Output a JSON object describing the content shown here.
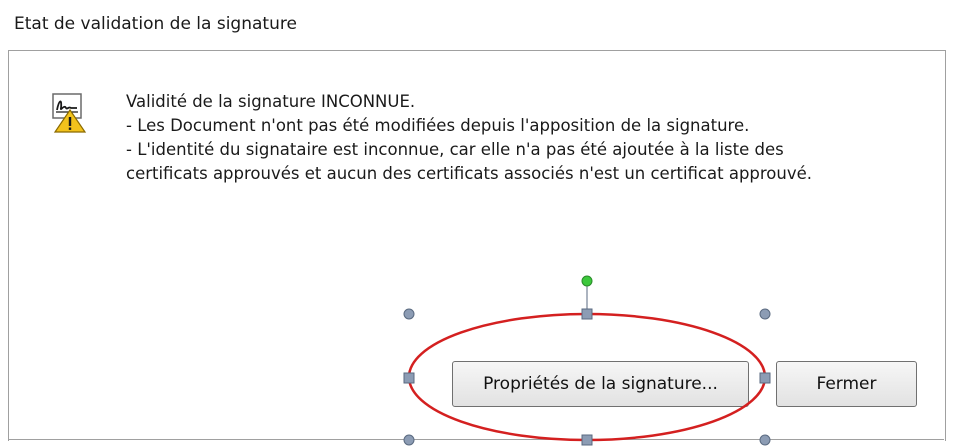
{
  "window": {
    "title": "Etat de validation de la signature"
  },
  "message": {
    "lines": [
      "Validité de la signature INCONNUE.",
      "- Les Document n'ont pas été modifiées depuis l'apposition de la signature.",
      "- L'identité du signataire est inconnue, car elle n'a pas été ajoutée à la liste des",
      "certificats approuvés et aucun des certificats associés n'est un certificat approuvé."
    ]
  },
  "buttons": {
    "properties_label": "Propriétés de la signature...",
    "close_label": "Fermer"
  },
  "icons": {
    "status_icon": "signature-warning-icon"
  },
  "colors": {
    "annotation_ellipse": "#d42020",
    "rotation_handle": "#3cc83c",
    "selection_handle": "#8c9cb4"
  }
}
